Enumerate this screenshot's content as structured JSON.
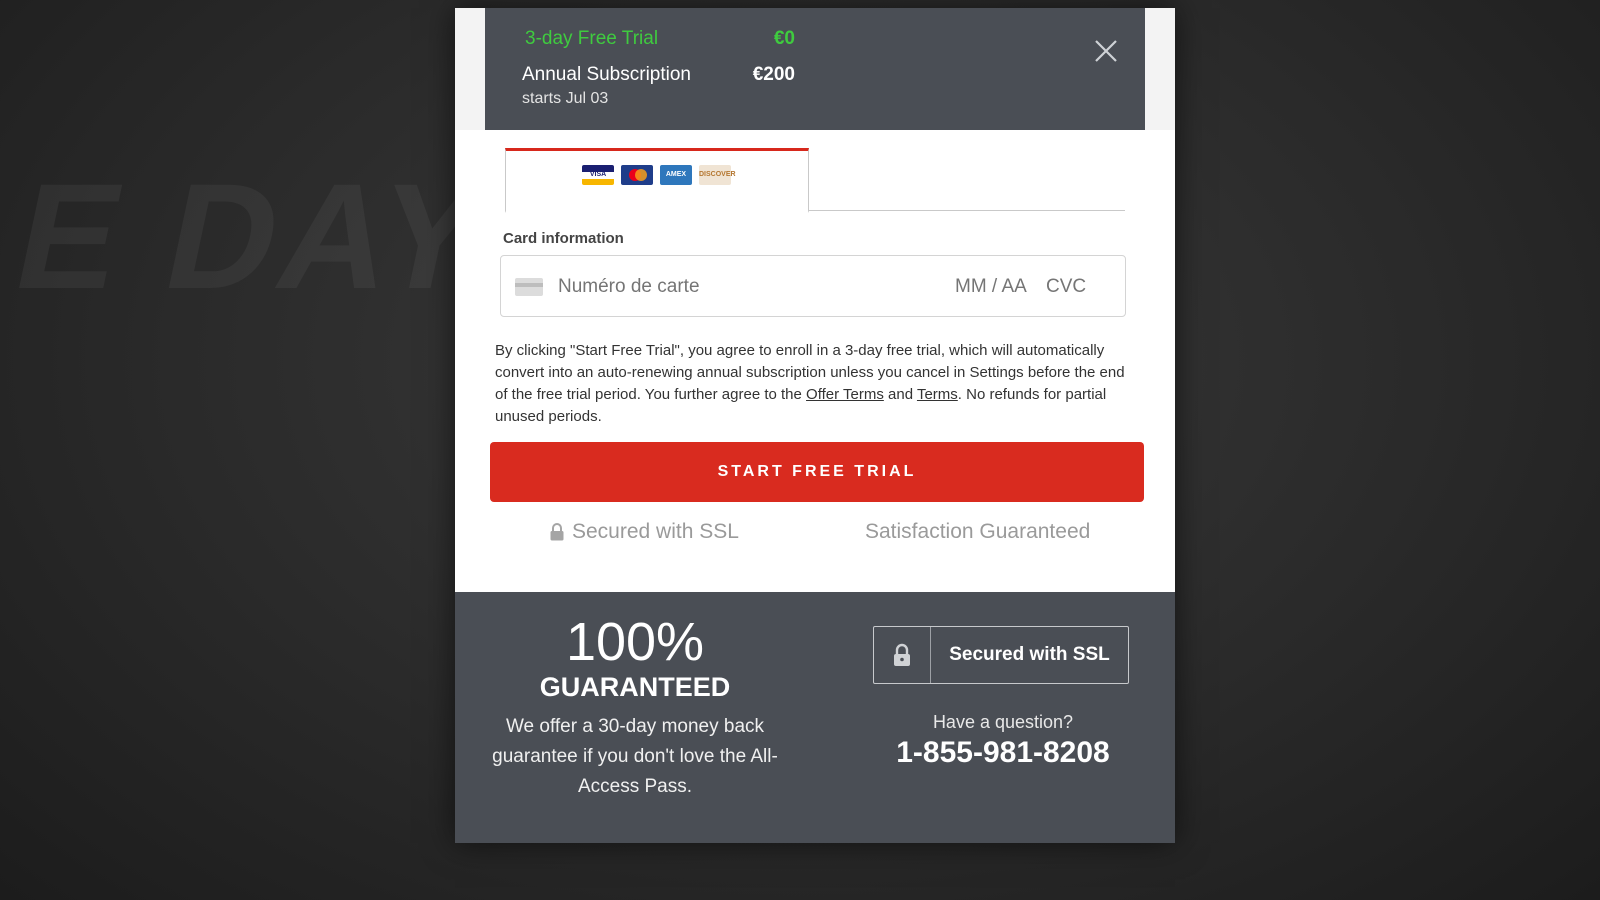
{
  "background": {
    "brand_text": "E DAY."
  },
  "header": {
    "trial_label": "3-day Free Trial",
    "trial_price": "€0",
    "annual_label": "Annual Subscription",
    "annual_price": "€200",
    "starts": "starts Jul 03",
    "close_icon": "close-icon"
  },
  "payment": {
    "card_logos": [
      "VISA",
      "MasterCard",
      "AMEX",
      "DISCOVER"
    ],
    "card_info_label": "Card information",
    "card_number_placeholder": "Numéro de carte",
    "expiry_placeholder": "MM / AA",
    "cvc_placeholder": "CVC"
  },
  "legal": {
    "part1": "By clicking \"Start Free Trial\", you agree to enroll in a 3-day free trial, which will automatically convert into an auto-renewing annual subscription unless you cancel in Settings before the end of the free trial period. You further agree to the ",
    "offer_terms": "Offer Terms",
    "part2": " and ",
    "terms": "Terms",
    "part3": ". No refunds for partial unused periods."
  },
  "cta_label": "START FREE TRIAL",
  "assurances": {
    "ssl": "Secured with SSL",
    "satisfaction": "Satisfaction Guaranteed"
  },
  "footer": {
    "percent": "100%",
    "guaranteed": "GUARANTEED",
    "guarantee_desc": "We offer a 30-day money back guarantee if you don't love the All-Access Pass.",
    "ssl_badge": "Secured with SSL",
    "question": "Have a question?",
    "phone": "1-855-981-8208"
  },
  "colors": {
    "accent_red": "#d92b1f",
    "trial_green": "#3fcb3f",
    "panel_gray": "#4a4e55"
  }
}
